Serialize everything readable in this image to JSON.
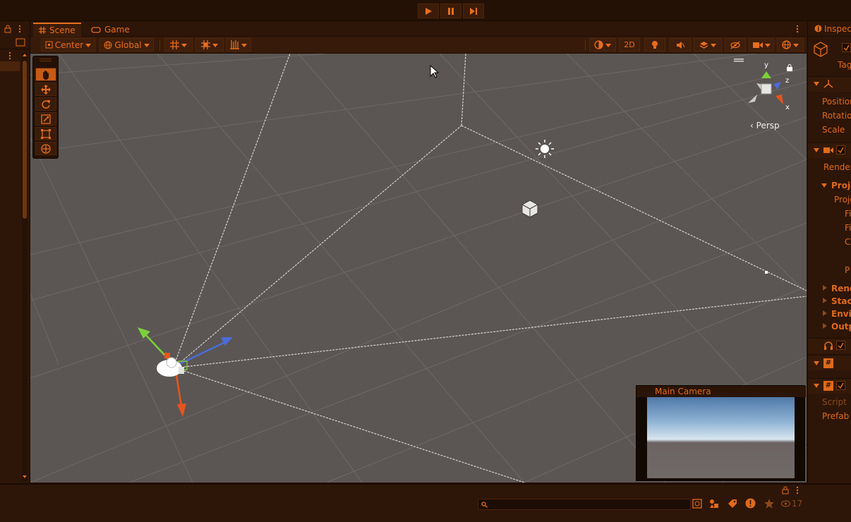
{
  "playbar": {
    "play_icon": "play-icon",
    "pause_icon": "pause-icon",
    "step_icon": "step-icon"
  },
  "tabs": [
    {
      "label": "Scene",
      "icon": "hash-icon"
    },
    {
      "label": "Game",
      "icon": "gamepad-icon"
    }
  ],
  "toolbar": {
    "pivot_label": "Center",
    "space_label": "Global",
    "mode_2d_label": "2D"
  },
  "viewport": {
    "orientation_label": "Persp",
    "gizmo_axes": [
      "y",
      "z",
      "x"
    ]
  },
  "camera_preview": {
    "title": "Main Camera"
  },
  "inspector": {
    "tab_label": "Inspec",
    "tag_label": "Tag",
    "transform_fields": [
      "Position",
      "Rotation",
      "Scale"
    ],
    "camera_fields": {
      "render": "Render",
      "projection_header": "Proje",
      "projection_sub": "Proje",
      "f1": "Fi",
      "f2": "Fi",
      "c": "C",
      "p": "P"
    },
    "sections": [
      "Rend",
      "Stac",
      "Envi",
      "Outp"
    ],
    "script_label": "Script",
    "prefab_label": "Prefab"
  },
  "bottom": {
    "hidden_count": "17"
  },
  "colors": {
    "accent": "#e86e1e",
    "bg": "#2a1407",
    "viewport": "#5b5653"
  }
}
